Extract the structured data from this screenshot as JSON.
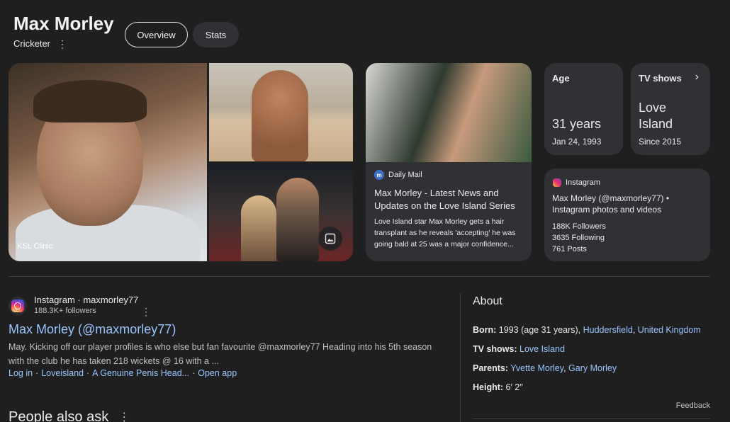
{
  "entity": {
    "name": "Max Morley",
    "type": "Cricketer"
  },
  "tabs": [
    {
      "label": "Overview"
    },
    {
      "label": "Stats"
    }
  ],
  "photos": {
    "main_caption": "KSL Clinic"
  },
  "news_card": {
    "source": "Daily Mail",
    "title": "Max Morley - Latest News and Updates on the Love Island Series ...",
    "snippet": "Love Island star Max Morley gets a hair transplant as he reveals 'accepting' he was going bald at 25 was a major confidence..."
  },
  "age_card": {
    "label": "Age",
    "value": "31 years",
    "sub": "Jan 24, 1993"
  },
  "tv_card": {
    "label": "TV shows",
    "value": "Love Island",
    "sub": "Since 2015"
  },
  "instagram_card": {
    "source": "Instagram",
    "title": "Max Morley (@maxmorley77) • Instagram photos and videos",
    "followers": "188K Followers",
    "following": "3635 Following",
    "posts": "761 Posts"
  },
  "result": {
    "site": "Instagram · maxmorley77",
    "followers": "188.3K+ followers",
    "title": "Max Morley (@maxmorley77)",
    "snippet": "May. Kicking off our player profiles is who else but fan favourite @maxmorley77 Heading into his 5th season with the club he has taken 218 wickets @ 16 with a ...",
    "links": [
      "Log in",
      "Loveisland",
      "A Genuine Penis Head...",
      "Open app"
    ],
    "link_sep": "·"
  },
  "people_also_ask": "People also ask",
  "about": {
    "title": "About",
    "born_label": "Born:",
    "born_text": " 1993 (age 31 years), ",
    "born_link1": "Huddersfield",
    "born_comma": ", ",
    "born_link2": "United Kingdom",
    "tv_label": "TV shows:",
    "tv_link": "Love Island",
    "parents_label": "Parents:",
    "parents_link1": "Yvette Morley",
    "parents_comma": ", ",
    "parents_link2": "Gary Morley",
    "height_label": "Height:",
    "height_value": " 6′ 2″"
  },
  "feedback": "Feedback",
  "icons": {
    "more": "⋮",
    "chevron": "›"
  },
  "colors": {
    "background": "#1f1f1f",
    "card": "#303134",
    "link": "#99c3ff"
  }
}
